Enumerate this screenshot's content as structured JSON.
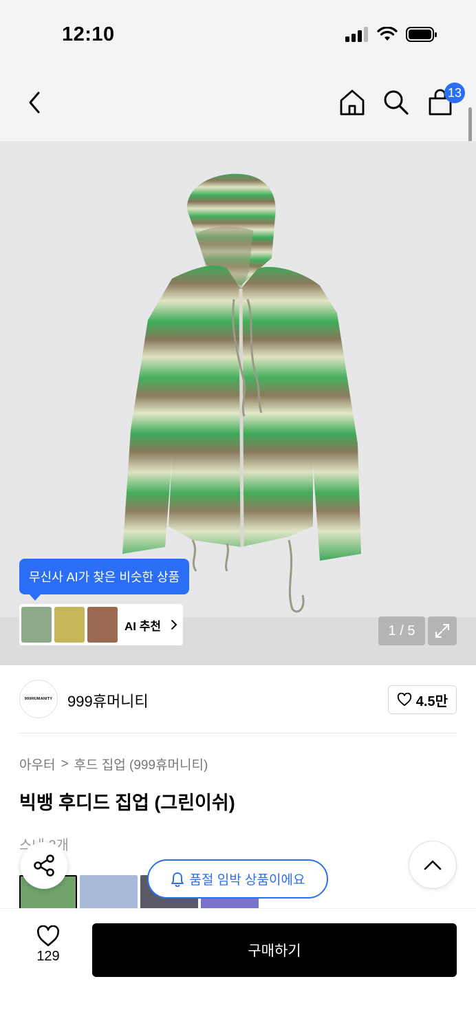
{
  "status_bar": {
    "time": "12:10"
  },
  "nav": {
    "cart_badge": "13"
  },
  "gallery": {
    "ai_tooltip": "무신사 AI가 찾은 비슷한 상품",
    "ai_label": "AI 추천",
    "page_indicator": "1 / 5",
    "colors": {
      "hoodie_green": "#3fae5a",
      "hoodie_brown": "#8a7a5c",
      "hoodie_cream": "#e3e6c8",
      "background": "#e7e7e9"
    }
  },
  "brand": {
    "logo_text": "999HUMANITY",
    "name": "999휴머니티",
    "likes": "4.5만"
  },
  "breadcrumb": {
    "category": "아우터",
    "separator": ">",
    "subcategory": "후드 집업 (999휴머니티)"
  },
  "product": {
    "title": "빅뱅 후디드 집업 (그린이쉬)"
  },
  "partial": {
    "text": "스내 2개"
  },
  "floating": {
    "soldout_label": "품절 임박 상품이에요"
  },
  "bottom": {
    "wish_count": "129",
    "buy_label": "구매하기"
  },
  "accent_color": "#2b6ef6"
}
